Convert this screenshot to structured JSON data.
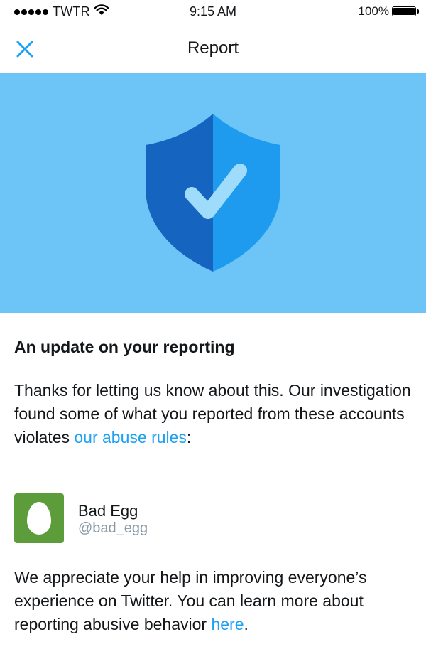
{
  "status_bar": {
    "carrier": "TWTR",
    "time": "9:15 AM",
    "battery": "100%"
  },
  "nav": {
    "title": "Report",
    "close_icon": "close-icon"
  },
  "hero": {
    "icon": "shield-check-icon",
    "background_color": "#6cc4f7",
    "shield_dark": "#1565c0",
    "shield_light": "#1e9bef",
    "check_color": "#9fdcfb"
  },
  "content": {
    "heading": "An update on your reporting",
    "para1_text": "Thanks for letting us know about this. Our investigation found some of what you reported from these accounts violates ",
    "para1_link": "our abuse rules",
    "para1_end": ":",
    "account": {
      "name": "Bad Egg",
      "handle": "@bad_egg",
      "avatar_color": "#5d9c3a"
    },
    "para2_text": "We appreciate your help in improving everyone’s experience on Twitter. You can learn more about reporting abusive behavior ",
    "para2_link": "here",
    "para2_end": "."
  },
  "colors": {
    "link": "#1da1f2",
    "text": "#14171a",
    "muted": "#8899a6"
  }
}
